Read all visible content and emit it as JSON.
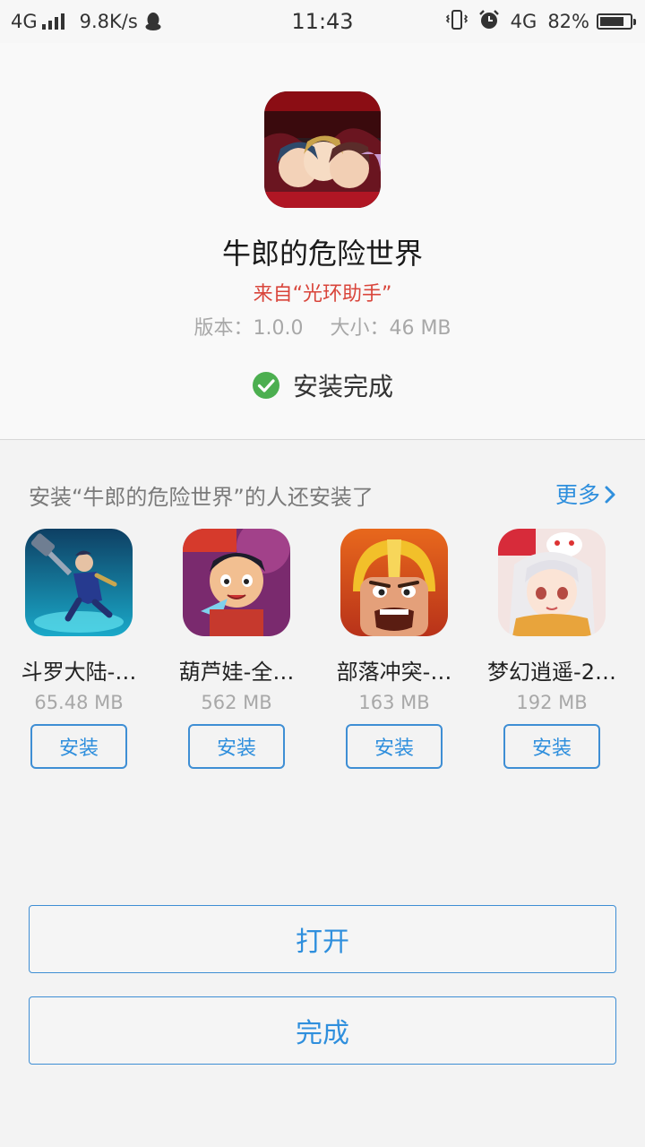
{
  "status_bar": {
    "network": "4G",
    "speed": "9.8K/s",
    "time": "11:43",
    "network2": "4G",
    "battery": "82%",
    "battery_level": 0.82,
    "icons": [
      "signal-icon",
      "qq-icon",
      "vibrate-icon",
      "alarm-icon",
      "battery-icon"
    ]
  },
  "app": {
    "name": "牛郎的危险世界",
    "source": "来自“光环助手”",
    "version": "版本：1.0.0",
    "size": "大小：46 MB",
    "status": "安装完成",
    "icon": "game-art-icon"
  },
  "recommendations": {
    "title": "安装“牛郎的危险世界”的人还安装了",
    "more_label": "更多",
    "items": [
      {
        "name": "斗罗大陆-…",
        "size": "65.48 MB",
        "install_label": "安装",
        "icon": "douluo-game-icon"
      },
      {
        "name": "葫芦娃-全…",
        "size": "562 MB",
        "install_label": "安装",
        "icon": "huluwa-game-icon"
      },
      {
        "name": "部落冲突-…",
        "size": "163 MB",
        "install_label": "安装",
        "icon": "clash-game-icon"
      },
      {
        "name": "梦幻逍遥-2…",
        "size": "192 MB",
        "install_label": "安装",
        "icon": "menghuan-game-icon"
      }
    ]
  },
  "actions": {
    "open_label": "打开",
    "done_label": "完成"
  },
  "colors": {
    "accent": "#2f8fdd",
    "source_red": "#d9453b",
    "success_green": "#4caf50"
  }
}
